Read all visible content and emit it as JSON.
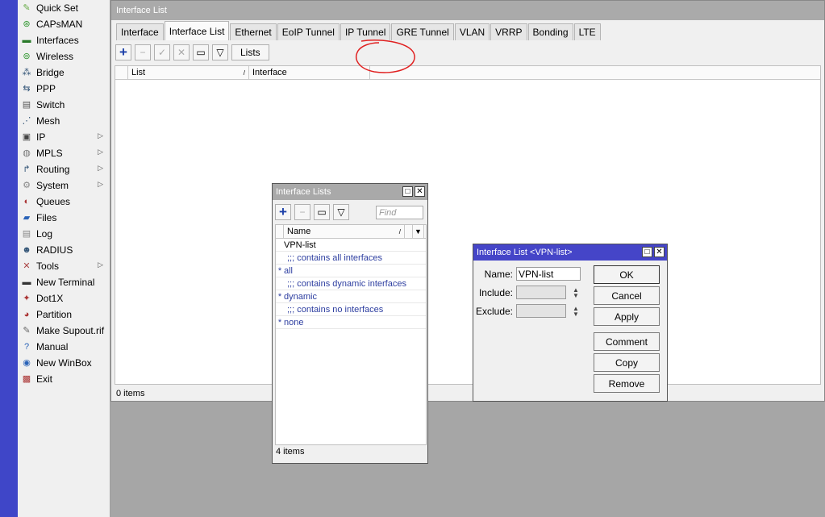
{
  "sidebar": {
    "items": [
      {
        "label": "Quick Set",
        "icon": "quickset-icon",
        "glyph": "✎",
        "color": "#6a4"
      },
      {
        "label": "CAPsMAN",
        "icon": "capsman-icon",
        "glyph": "⊛",
        "color": "#393"
      },
      {
        "label": "Interfaces",
        "icon": "interfaces-icon",
        "glyph": "▬",
        "color": "#2a7a2a"
      },
      {
        "label": "Wireless",
        "icon": "wireless-icon",
        "glyph": "⊚",
        "color": "#393"
      },
      {
        "label": "Bridge",
        "icon": "bridge-icon",
        "glyph": "⁂",
        "color": "#357"
      },
      {
        "label": "PPP",
        "icon": "ppp-icon",
        "glyph": "⇆",
        "color": "#357"
      },
      {
        "label": "Switch",
        "icon": "switch-icon",
        "glyph": "▤",
        "color": "#555"
      },
      {
        "label": "Mesh",
        "icon": "mesh-icon",
        "glyph": "⋰",
        "color": "#357"
      },
      {
        "label": "IP",
        "icon": "ip-icon",
        "glyph": "▣",
        "color": "#444",
        "arrow": true
      },
      {
        "label": "MPLS",
        "icon": "mpls-icon",
        "glyph": "◍",
        "color": "#777",
        "arrow": true
      },
      {
        "label": "Routing",
        "icon": "routing-icon",
        "glyph": "↱",
        "color": "#357",
        "arrow": true
      },
      {
        "label": "System",
        "icon": "system-icon",
        "glyph": "⚙",
        "color": "#888",
        "arrow": true
      },
      {
        "label": "Queues",
        "icon": "queues-icon",
        "glyph": "◐",
        "color": "#a33"
      },
      {
        "label": "Files",
        "icon": "files-icon",
        "glyph": "▰",
        "color": "#2a63b8"
      },
      {
        "label": "Log",
        "icon": "log-icon",
        "glyph": "▤",
        "color": "#888"
      },
      {
        "label": "RADIUS",
        "icon": "radius-icon",
        "glyph": "☻",
        "color": "#357"
      },
      {
        "label": "Tools",
        "icon": "tools-icon",
        "glyph": "✕",
        "color": "#a44",
        "arrow": true
      },
      {
        "label": "New Terminal",
        "icon": "terminal-icon",
        "glyph": "▬",
        "color": "#333"
      },
      {
        "label": "Dot1X",
        "icon": "dot1x-icon",
        "glyph": "✦",
        "color": "#a33"
      },
      {
        "label": "Partition",
        "icon": "partition-icon",
        "glyph": "◕",
        "color": "#a33"
      },
      {
        "label": "Make Supout.rif",
        "icon": "supout-icon",
        "glyph": "✎",
        "color": "#666"
      },
      {
        "label": "Manual",
        "icon": "manual-icon",
        "glyph": "?",
        "color": "#2a63b8"
      },
      {
        "label": "New WinBox",
        "icon": "winbox-icon",
        "glyph": "◉",
        "color": "#2a63b8"
      },
      {
        "label": "Exit",
        "icon": "exit-icon",
        "glyph": "▩",
        "color": "#a33"
      }
    ]
  },
  "main": {
    "title": "Interface List",
    "tabs": [
      "Interface",
      "Interface List",
      "Ethernet",
      "EoIP Tunnel",
      "IP Tunnel",
      "GRE Tunnel",
      "VLAN",
      "VRRP",
      "Bonding",
      "LTE"
    ],
    "active_tab": 1,
    "lists_button": "Lists",
    "columns": [
      "List",
      "Interface"
    ],
    "status": "0 items"
  },
  "lists_window": {
    "title": "Interface Lists",
    "find_placeholder": "Find",
    "column": "Name",
    "rows": [
      {
        "star": "",
        "text": "VPN-list",
        "kind": "plain"
      },
      {
        "star": "",
        "text": ";;; contains all interfaces",
        "kind": "comment"
      },
      {
        "star": "*",
        "text": "all",
        "kind": "entry"
      },
      {
        "star": "",
        "text": ";;; contains dynamic interfaces",
        "kind": "comment"
      },
      {
        "star": "*",
        "text": "dynamic",
        "kind": "entry"
      },
      {
        "star": "",
        "text": ";;; contains no interfaces",
        "kind": "comment"
      },
      {
        "star": "*",
        "text": "none",
        "kind": "entry"
      }
    ],
    "status": "4 items"
  },
  "dialog": {
    "title": "Interface List <VPN-list>",
    "name_label": "Name:",
    "name_value": "VPN-list",
    "include_label": "Include:",
    "exclude_label": "Exclude:",
    "buttons": {
      "ok": "OK",
      "cancel": "Cancel",
      "apply": "Apply",
      "comment": "Comment",
      "copy": "Copy",
      "remove": "Remove"
    }
  },
  "colors": {
    "accent": "#3f46c8",
    "annotation": "#e02020"
  }
}
